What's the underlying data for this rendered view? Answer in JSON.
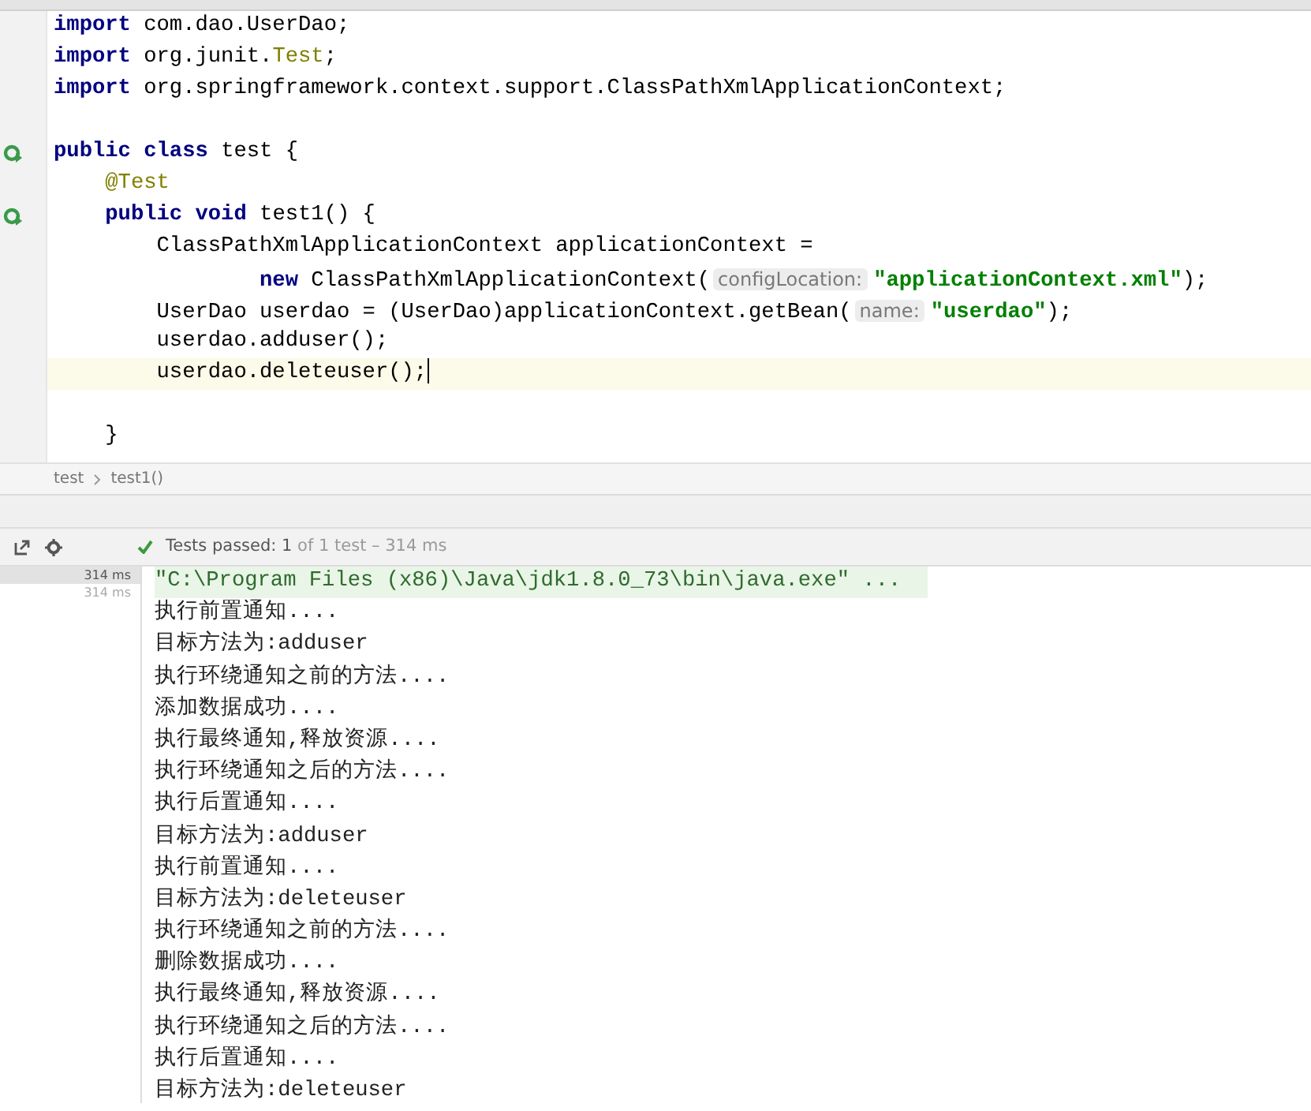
{
  "editor": {
    "lines": [
      {
        "run": false,
        "current": false,
        "tokens": [
          {
            "kind": "keyword",
            "text": "import"
          },
          {
            "kind": "plain",
            "text": " com.dao.UserDao;"
          }
        ]
      },
      {
        "run": false,
        "current": false,
        "tokens": [
          {
            "kind": "keyword",
            "text": "import"
          },
          {
            "kind": "plain",
            "text": " org.junit."
          },
          {
            "kind": "type",
            "text": "Test"
          },
          {
            "kind": "plain",
            "text": ";"
          }
        ]
      },
      {
        "run": false,
        "current": false,
        "tokens": [
          {
            "kind": "keyword",
            "text": "import"
          },
          {
            "kind": "plain",
            "text": " org.springframework.context.support.ClassPathXmlApplicationContext;"
          }
        ]
      },
      {
        "run": false,
        "current": false
      },
      {
        "run": true,
        "current": false,
        "tokens": [
          {
            "kind": "keyword",
            "text": "public class"
          },
          {
            "kind": "plain",
            "text": " test {"
          }
        ]
      },
      {
        "run": false,
        "current": false,
        "tokens": [
          {
            "kind": "annotation",
            "text": "    @Test"
          }
        ]
      },
      {
        "run": true,
        "current": false,
        "tokens": [
          {
            "kind": "keyword",
            "text": "    public void"
          },
          {
            "kind": "plain",
            "text": " test1() {"
          }
        ]
      },
      {
        "run": false,
        "current": false,
        "tokens": [
          {
            "kind": "plain",
            "text": "        ClassPathXmlApplicationContext applicationContext ="
          }
        ]
      },
      {
        "run": false,
        "current": false,
        "tokens": [
          {
            "kind": "keyword",
            "text": "                new"
          },
          {
            "kind": "plain",
            "text": " ClassPathXmlApplicationContext("
          },
          {
            "kind": "hint",
            "text": "configLocation:"
          },
          {
            "kind": "string",
            "text": "\"applicationContext.xml\""
          },
          {
            "kind": "plain",
            "text": ");"
          }
        ]
      },
      {
        "run": false,
        "current": false,
        "tokens": [
          {
            "kind": "plain",
            "text": "        UserDao userdao = (UserDao)applicationContext.getBean("
          },
          {
            "kind": "hint",
            "text": "name:"
          },
          {
            "kind": "string",
            "text": "\"userdao\""
          },
          {
            "kind": "plain",
            "text": ");"
          }
        ]
      },
      {
        "run": false,
        "current": false,
        "tokens": [
          {
            "kind": "plain",
            "text": "        userdao.adduser();"
          }
        ]
      },
      {
        "run": false,
        "current": true,
        "tokens": [
          {
            "kind": "plain",
            "text": "        userdao.deleteuser();"
          }
        ]
      },
      {
        "run": false,
        "current": false
      },
      {
        "run": false,
        "current": false,
        "tokens": [
          {
            "kind": "plain",
            "text": "    }"
          }
        ]
      }
    ]
  },
  "breadcrumbs": [
    "test",
    "test1()"
  ],
  "test_status": "**Tests passed: 1** of 1 test – 314 ms",
  "test_tree": [
    {
      "time": "314 ms",
      "selected": true
    },
    {
      "time": "314 ms",
      "selected": false
    }
  ],
  "console": [
    {
      "kind": "command",
      "text": "\"C:\\Program Files (x86)\\Java\\jdk1.8.0_73\\bin\\java.exe\" ..."
    },
    {
      "kind": "output",
      "text": "执行前置通知...."
    },
    {
      "kind": "output",
      "text": "目标方法为:adduser"
    },
    {
      "kind": "output",
      "text": "执行环绕通知之前的方法...."
    },
    {
      "kind": "output",
      "text": "添加数据成功...."
    },
    {
      "kind": "output",
      "text": "执行最终通知,释放资源...."
    },
    {
      "kind": "output",
      "text": "执行环绕通知之后的方法...."
    },
    {
      "kind": "output",
      "text": "执行后置通知...."
    },
    {
      "kind": "output",
      "text": "目标方法为:adduser"
    },
    {
      "kind": "output",
      "text": "执行前置通知...."
    },
    {
      "kind": "output",
      "text": "目标方法为:deleteuser"
    },
    {
      "kind": "output",
      "text": "执行环绕通知之前的方法...."
    },
    {
      "kind": "output",
      "text": "删除数据成功...."
    },
    {
      "kind": "output",
      "text": "执行最终通知,释放资源...."
    },
    {
      "kind": "output",
      "text": "执行环绕通知之后的方法...."
    },
    {
      "kind": "output",
      "text": "执行后置通知...."
    },
    {
      "kind": "output",
      "text": "目标方法为:deleteuser"
    }
  ]
}
